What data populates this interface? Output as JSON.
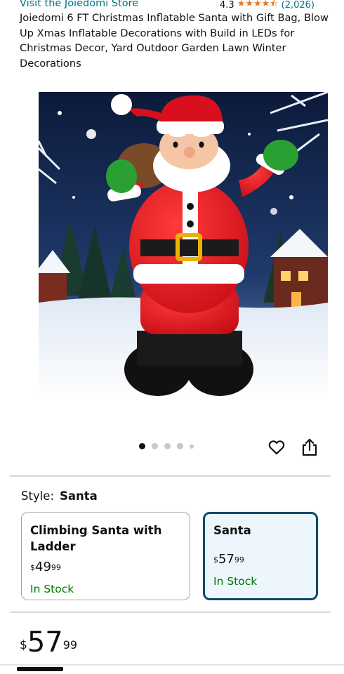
{
  "store": {
    "link_text": "Visit the Joiedomi Store"
  },
  "rating": {
    "value": "4.3",
    "stars": "★★★★⯪",
    "count": "(2,026)"
  },
  "product": {
    "title": "Joiedomi 6 FT Christmas Inflatable Santa with Gift Bag, Blow Up Xmas Inflatable Decorations with Build in LEDs for Christmas Decor, Yard Outdoor Garden Lawn Winter Decorations",
    "image_count": 5,
    "active_image_index": 1
  },
  "style_selector": {
    "label": "Style:",
    "selected": "Santa",
    "options": [
      {
        "name": "Climbing Santa with Ladder",
        "price_symbol": "$",
        "price_whole": "49",
        "price_cents": "99",
        "stock": "In Stock"
      },
      {
        "name": "Santa",
        "price_symbol": "$",
        "price_whole": "57",
        "price_cents": "99",
        "stock": "In Stock"
      }
    ]
  },
  "price": {
    "symbol": "$",
    "whole": "57",
    "cents": "99"
  },
  "colors": {
    "link": "#007185",
    "star": "#de7921",
    "in_stock": "#007600",
    "selected_border": "#0a4a6b",
    "selected_bg": "#edf6fc"
  }
}
